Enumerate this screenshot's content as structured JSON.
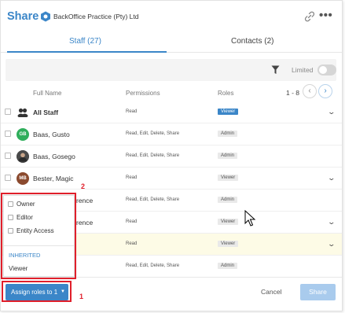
{
  "header": {
    "title": "Share",
    "org_name": "BackOffice Practice (Pty) Ltd",
    "more_glyph": "•••"
  },
  "tabs": [
    {
      "label": "Staff (27)",
      "active": true
    },
    {
      "label": "Contacts (2)",
      "active": false
    }
  ],
  "filter": {
    "search_placeholder": "",
    "limited_label": "Limited",
    "limited_on": false
  },
  "columns": {
    "name": "Full Name",
    "permissions": "Permissions",
    "roles": "Roles"
  },
  "pager": {
    "label": "1 - 8",
    "prev": "‹",
    "next": "›"
  },
  "rows": [
    {
      "name": "All Staff",
      "permissions": "Read",
      "role": "Viewer",
      "role_style": "blue",
      "avatar": "group",
      "expandable": true
    },
    {
      "name": "Baas, Gusto",
      "permissions": "Read, Edit, Delete, Share",
      "role": "Admin",
      "avatar_initials": "GB",
      "avatar_color": "#2fae5b",
      "expandable": false
    },
    {
      "name": "Baas, Gosego",
      "permissions": "Read, Edit, Delete, Share",
      "role": "Admin",
      "avatar": "photo",
      "expandable": false
    },
    {
      "name": "Bester, Magic",
      "permissions": "Read",
      "role": "Viewer",
      "avatar_initials": "MB",
      "avatar_color": "#8b4a2e",
      "expandable": true
    },
    {
      "name": "rence",
      "permissions": "Read, Edit, Delete, Share",
      "role": "Admin",
      "expandable": false
    },
    {
      "name": "rence",
      "permissions": "Read",
      "role": "Viewer",
      "expandable": true
    },
    {
      "name": "",
      "permissions": "Read",
      "role": "Viewer",
      "expandable": true,
      "highlighted": true
    },
    {
      "name": "",
      "permissions": "Read, Edit, Delete, Share",
      "role": "Admin",
      "expandable": false
    }
  ],
  "role_menu": {
    "options": [
      "Owner",
      "Editor",
      "Entity Access"
    ],
    "inherited_heading": "INHERITED",
    "inherited_role": "Viewer"
  },
  "annotations": {
    "box_1_number": "1",
    "box_2_number": "2",
    "color": "#e01f2b"
  },
  "footer": {
    "assign_label": "Assign roles to 1",
    "caret": "▼",
    "cancel_label": "Cancel",
    "share_label": "Share"
  },
  "colors": {
    "accent": "#3b86c8",
    "highlight_row": "#fdfbe6"
  }
}
